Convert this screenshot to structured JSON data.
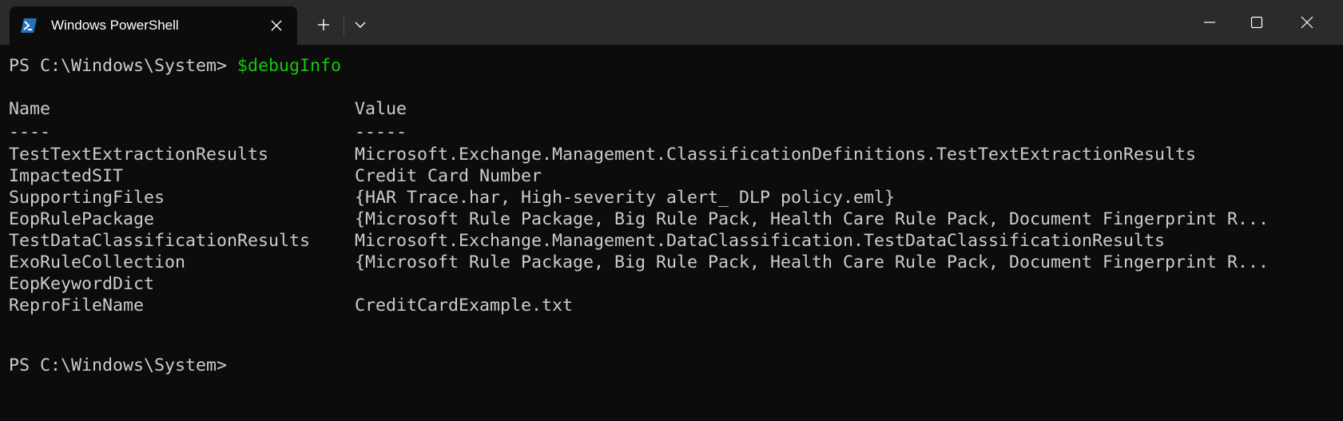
{
  "titlebar": {
    "tab_title": "Windows PowerShell",
    "tab_icon": "powershell-icon",
    "close_tab_icon": "close-icon",
    "new_tab_icon": "plus-icon",
    "dropdown_icon": "chevron-down-icon",
    "minimize_icon": "minimize-icon",
    "maximize_icon": "maximize-icon",
    "close_window_icon": "close-icon"
  },
  "terminal": {
    "prompt": "PS C:\\Windows\\System> ",
    "command": "$debugInfo",
    "header": {
      "name": "Name",
      "value": "Value"
    },
    "separator": {
      "name": "----",
      "value": "-----"
    },
    "rows": [
      {
        "name": "TestTextExtractionResults",
        "value": "Microsoft.Exchange.Management.ClassificationDefinitions.TestTextExtractionResults"
      },
      {
        "name": "ImpactedSIT",
        "value": "Credit Card Number"
      },
      {
        "name": "SupportingFiles",
        "value": "{HAR Trace.har, High-severity alert_ DLP policy.eml}"
      },
      {
        "name": "EopRulePackage",
        "value": "{Microsoft Rule Package, Big Rule Pack, Health Care Rule Pack, Document Fingerprint R..."
      },
      {
        "name": "TestDataClassificationResults",
        "value": "Microsoft.Exchange.Management.DataClassification.TestDataClassificationResults"
      },
      {
        "name": "ExoRuleCollection",
        "value": "{Microsoft Rule Package, Big Rule Pack, Health Care Rule Pack, Document Fingerprint R..."
      },
      {
        "name": "EopKeywordDict",
        "value": ""
      },
      {
        "name": "ReproFileName",
        "value": "CreditCardExample.txt"
      }
    ],
    "prompt2": "PS C:\\Windows\\System>"
  },
  "colors": {
    "background": "#0c0c0c",
    "titlebar": "#2b2b2b",
    "text": "#cccccc",
    "command": "#16c60c",
    "powershell_blue": "#2671be"
  }
}
